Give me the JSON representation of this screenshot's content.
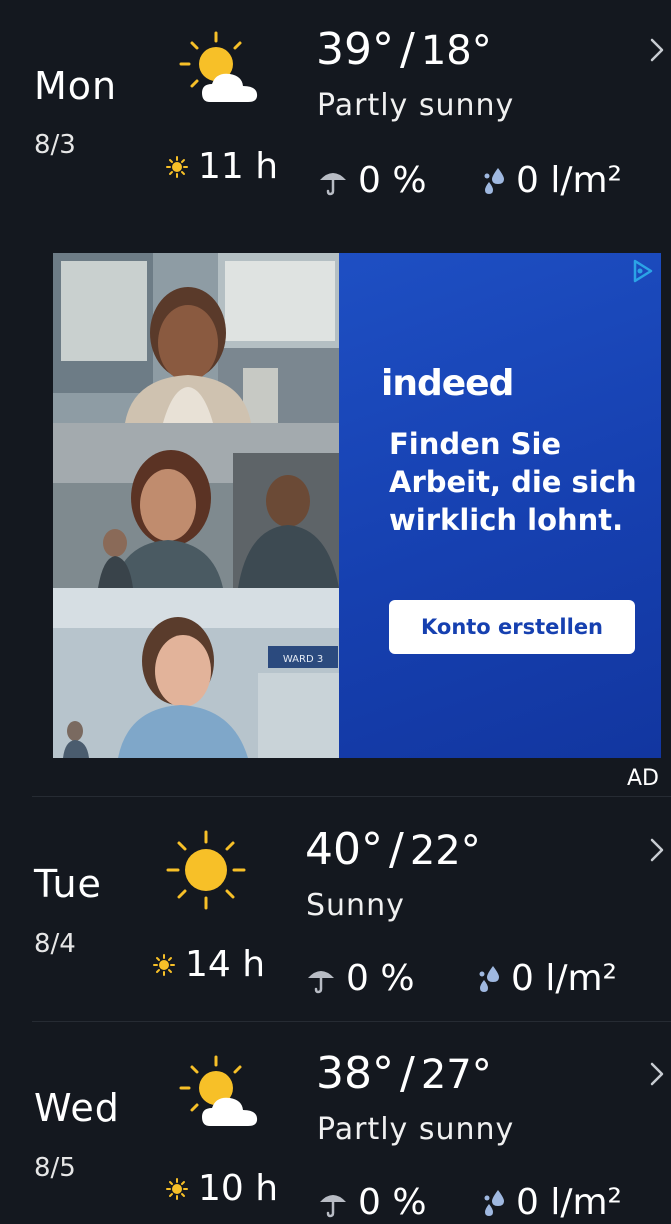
{
  "days": [
    {
      "name": "Mon",
      "date": "8/3",
      "high": "39°",
      "low": "18°",
      "condition": "Partly sunny",
      "icon": "partly-sunny-icon",
      "sun_hours": "11 h",
      "precip_chance": "0 %",
      "rain_amount": "0 l/m²"
    },
    {
      "name": "Tue",
      "date": "8/4",
      "high": "40°",
      "low": "22°",
      "condition": "Sunny",
      "icon": "sunny-icon",
      "sun_hours": "14 h",
      "precip_chance": "0 %",
      "rain_amount": "0 l/m²"
    },
    {
      "name": "Wed",
      "date": "8/5",
      "high": "38°",
      "low": "27°",
      "condition": "Partly sunny",
      "icon": "partly-sunny-icon",
      "sun_hours": "10 h",
      "precip_chance": "0 %",
      "rain_amount": "0 l/m²"
    }
  ],
  "temp_separator": "/",
  "ad": {
    "brand": "indeed",
    "headline": "Finden Sie Arbeit, die sich wirklich lohnt.",
    "cta": "Konto erstellen",
    "label": "AD",
    "sign_text": "WARD 3"
  },
  "colors": {
    "background": "#14181f",
    "sun": "#f7c028",
    "cloud": "#ffffff",
    "rain_drop": "#9fb8e0",
    "ad_blue": "#1640b0"
  }
}
